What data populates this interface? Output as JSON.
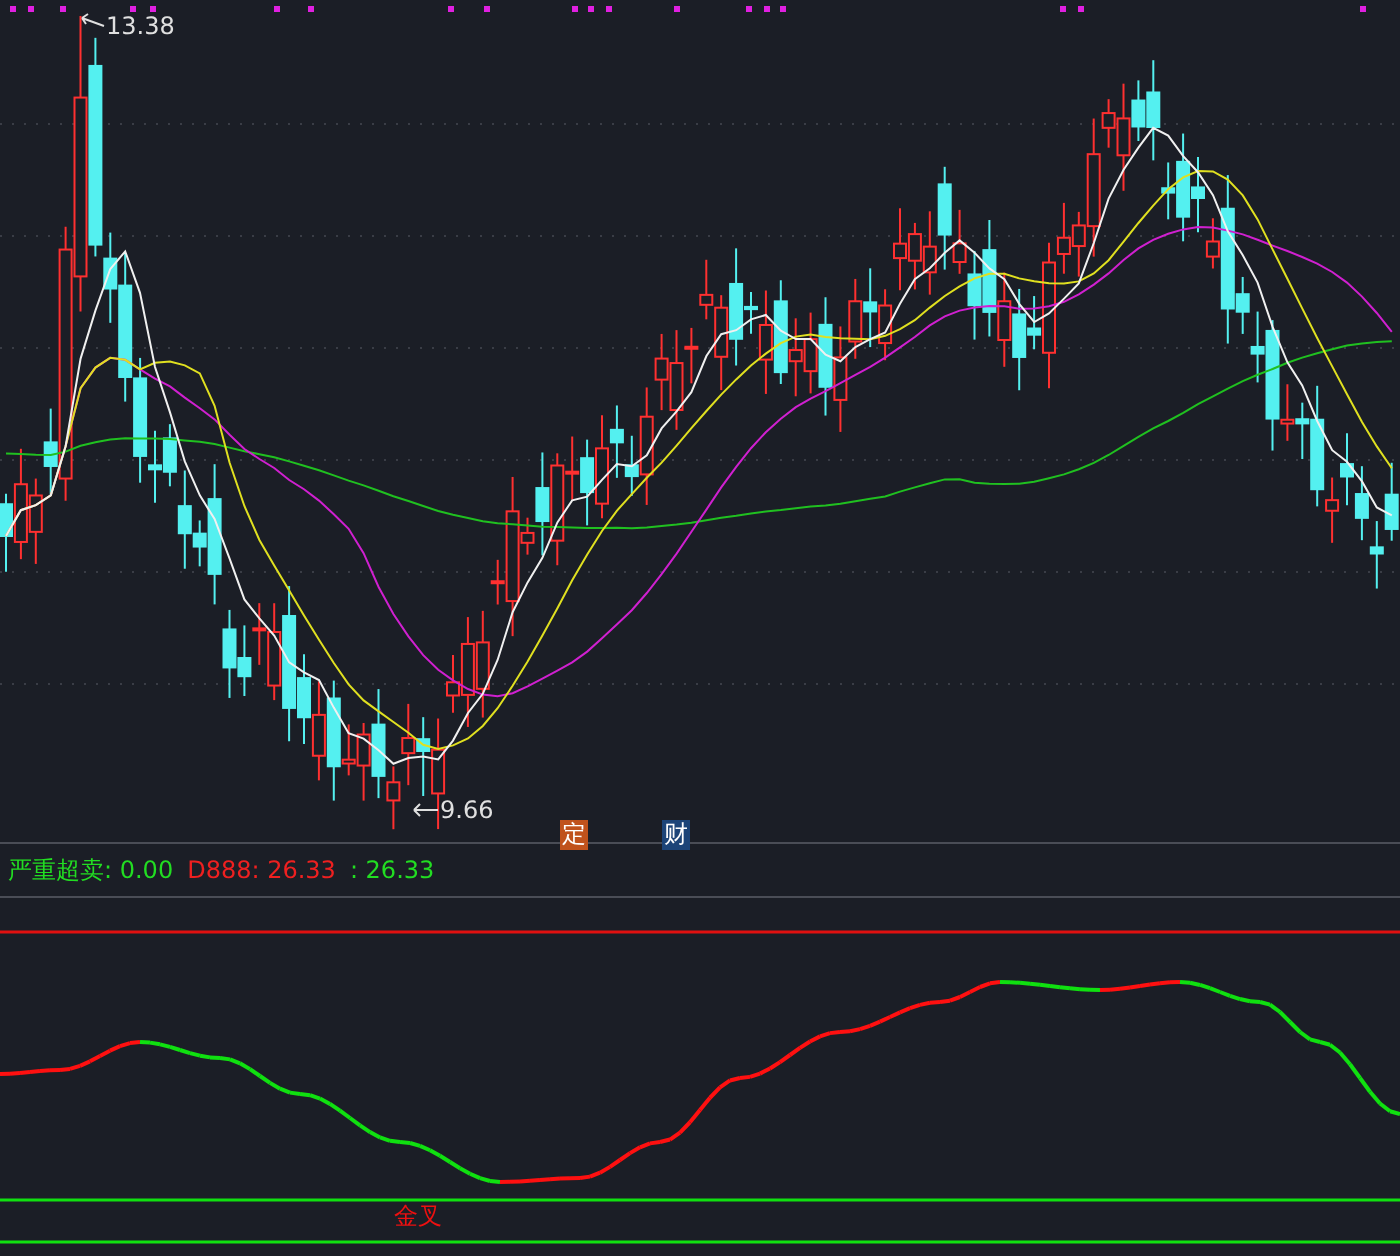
{
  "main_chart": {
    "high_label": "13.38",
    "low_label": "9.66",
    "markers": [
      {
        "text": "定",
        "color": "#c0521c"
      },
      {
        "text": "财",
        "color": "#1c4478"
      }
    ]
  },
  "legend": [
    {
      "text": "严重超卖: 0.00",
      "color": "#22dd22"
    },
    {
      "text": "D888: 26.33",
      "color": "#ee2020"
    },
    {
      "text": ": 26.33",
      "color": "#22dd22"
    }
  ],
  "indicator_chart": {
    "signal_label": "金叉"
  }
}
